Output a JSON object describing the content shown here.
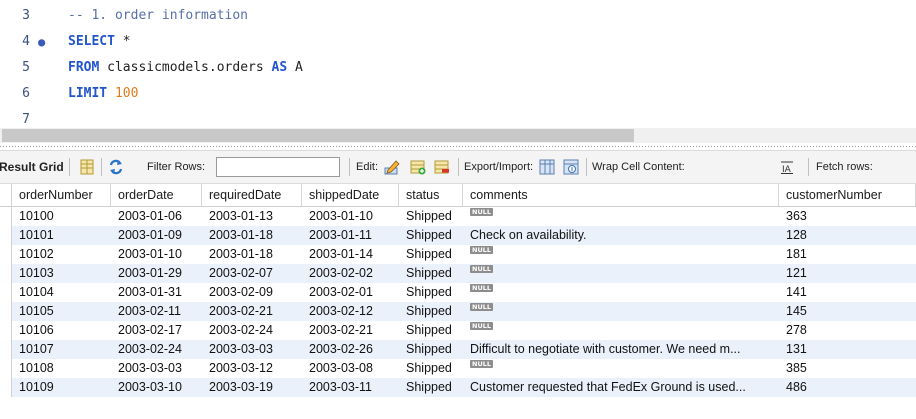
{
  "editor": {
    "lines": [
      {
        "number": "3",
        "marker": "",
        "tokens": [
          {
            "t": "comment",
            "v": "-- 1. order information"
          }
        ]
      },
      {
        "number": "4",
        "marker": "●",
        "tokens": [
          {
            "t": "kw",
            "v": "SELECT"
          },
          {
            "t": "text",
            "v": " *"
          }
        ]
      },
      {
        "number": "5",
        "marker": "",
        "tokens": [
          {
            "t": "kw",
            "v": "FROM"
          },
          {
            "t": "text",
            "v": " classicmodels.orders "
          },
          {
            "t": "kw",
            "v": "AS"
          },
          {
            "t": "text",
            "v": " A"
          }
        ]
      },
      {
        "number": "6",
        "marker": "",
        "tokens": [
          {
            "t": "kw",
            "v": "LIMIT"
          },
          {
            "t": "text",
            "v": " "
          },
          {
            "t": "num",
            "v": "100"
          }
        ]
      },
      {
        "number": "7",
        "marker": "",
        "tokens": []
      }
    ]
  },
  "toolbar": {
    "result_grid": "Result Grid",
    "filter_rows": "Filter Rows:",
    "filter_value": "",
    "edit": "Edit:",
    "export_import": "Export/Import:",
    "wrap_cell": "Wrap Cell Content:",
    "fetch_rows": "Fetch rows:"
  },
  "grid": {
    "columns": [
      "orderNumber",
      "orderDate",
      "requiredDate",
      "shippedDate",
      "status",
      "comments",
      "customerNumber"
    ],
    "null_label": "NULL",
    "rows": [
      [
        "10100",
        "2003-01-06",
        "2003-01-13",
        "2003-01-10",
        "Shipped",
        null,
        "363"
      ],
      [
        "10101",
        "2003-01-09",
        "2003-01-18",
        "2003-01-11",
        "Shipped",
        "Check on availability.",
        "128"
      ],
      [
        "10102",
        "2003-01-10",
        "2003-01-18",
        "2003-01-14",
        "Shipped",
        null,
        "181"
      ],
      [
        "10103",
        "2003-01-29",
        "2003-02-07",
        "2003-02-02",
        "Shipped",
        null,
        "121"
      ],
      [
        "10104",
        "2003-01-31",
        "2003-02-09",
        "2003-02-01",
        "Shipped",
        null,
        "141"
      ],
      [
        "10105",
        "2003-02-11",
        "2003-02-21",
        "2003-02-12",
        "Shipped",
        null,
        "145"
      ],
      [
        "10106",
        "2003-02-17",
        "2003-02-24",
        "2003-02-21",
        "Shipped",
        null,
        "278"
      ],
      [
        "10107",
        "2003-02-24",
        "2003-03-03",
        "2003-02-26",
        "Shipped",
        "Difficult to negotiate with customer. We need m...",
        "131"
      ],
      [
        "10108",
        "2003-03-03",
        "2003-03-12",
        "2003-03-08",
        "Shipped",
        null,
        "385"
      ],
      [
        "10109",
        "2003-03-10",
        "2003-03-19",
        "2003-03-11",
        "Shipped",
        "Customer requested that FedEx Ground is used...",
        "486"
      ]
    ]
  },
  "colors": {
    "keyword": "#2255cc",
    "comment": "#5a6fa8",
    "number": "#e07b1a",
    "row_alt": "#eaf1fb"
  }
}
